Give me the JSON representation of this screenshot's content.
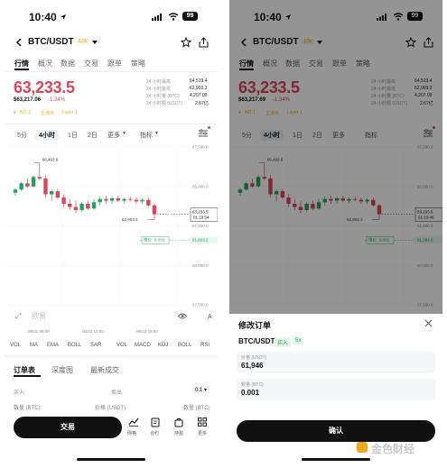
{
  "status": {
    "time": "10:40",
    "battery": "99"
  },
  "header": {
    "pair": "BTC/USDT",
    "leverage": "10x"
  },
  "tabs": [
    "行情",
    "概况",
    "数据",
    "交易",
    "跟单",
    "策略"
  ],
  "price": {
    "last": "63,233.5",
    "last_modal": "63,233.5",
    "usd": "$63,217.06",
    "usd_modal": "$63,217.69",
    "change": "-1.34%",
    "rank": "NO.1",
    "tag_main": "主流币",
    "tag_layer": "Layer 1"
  },
  "stats": [
    {
      "label": "24 小时最高",
      "value": "64,519.4"
    },
    {
      "label": "24 小时最低",
      "value": "62,903.3"
    },
    {
      "label": "24 小时量 (BTC)",
      "value": "4,207.09"
    },
    {
      "label": "24 小时额 (USDT)",
      "value": "2.67亿"
    }
  ],
  "intervals": [
    "5分",
    "4小时",
    "1日",
    "2日",
    "更多",
    "指标"
  ],
  "chart": {
    "yticks": [
      "67,500.0",
      "65,000.0",
      "62,500.0",
      "60,000.0",
      "57,500.0"
    ],
    "xticks": [
      "06/21 08:00",
      "06/22 12:00",
      "06/23 16:00"
    ],
    "high_label": "66,493.9",
    "low_label": "62,903.3",
    "current_price": "63,233.5",
    "countdown": "01:19:54",
    "countdown_modal": "01:19:46",
    "order_tag": "限价",
    "order_qty": "0.001",
    "order_price": "61,603.2",
    "order_price_modal": "61,094.6",
    "watermark": "欧易"
  },
  "chart_data": {
    "type": "candlestick",
    "ylim": [
      57500,
      67500
    ],
    "high": 66493.9,
    "low": 62903.3,
    "last": 63233.5,
    "candles": [
      {
        "o": 64600,
        "h": 64900,
        "l": 64400,
        "c": 64800
      },
      {
        "o": 64800,
        "h": 65300,
        "l": 64700,
        "c": 65200
      },
      {
        "o": 65200,
        "h": 65500,
        "l": 64900,
        "c": 65000
      },
      {
        "o": 65000,
        "h": 65700,
        "l": 64950,
        "c": 65600
      },
      {
        "o": 65600,
        "h": 66493.9,
        "l": 65400,
        "c": 65500
      },
      {
        "o": 65500,
        "h": 65700,
        "l": 64300,
        "c": 64500
      },
      {
        "o": 64500,
        "h": 64800,
        "l": 64100,
        "c": 64700
      },
      {
        "o": 64700,
        "h": 64850,
        "l": 64200,
        "c": 64300
      },
      {
        "o": 64300,
        "h": 64500,
        "l": 63700,
        "c": 63900
      },
      {
        "o": 63900,
        "h": 64200,
        "l": 63500,
        "c": 63700
      },
      {
        "o": 63700,
        "h": 64100,
        "l": 63300,
        "c": 63500
      },
      {
        "o": 63500,
        "h": 64000,
        "l": 63400,
        "c": 63900
      },
      {
        "o": 63900,
        "h": 64100,
        "l": 63500,
        "c": 63600
      },
      {
        "o": 63600,
        "h": 64200,
        "l": 63500,
        "c": 64000
      },
      {
        "o": 64000,
        "h": 64350,
        "l": 63800,
        "c": 64200
      },
      {
        "o": 64200,
        "h": 64400,
        "l": 63900,
        "c": 64100
      },
      {
        "o": 64100,
        "h": 64350,
        "l": 63900,
        "c": 64250
      },
      {
        "o": 64250,
        "h": 64400,
        "l": 64000,
        "c": 64100
      },
      {
        "o": 64100,
        "h": 64300,
        "l": 63950,
        "c": 64200
      },
      {
        "o": 64200,
        "h": 64350,
        "l": 64050,
        "c": 64150
      },
      {
        "o": 64150,
        "h": 64300,
        "l": 63900,
        "c": 64050
      },
      {
        "o": 64050,
        "h": 64250,
        "l": 63900,
        "c": 64150
      },
      {
        "o": 64150,
        "h": 64300,
        "l": 63700,
        "c": 63800
      },
      {
        "o": 63800,
        "h": 63900,
        "l": 62903.3,
        "c": 63233.5
      }
    ]
  },
  "indicators": [
    "VOL",
    "MA",
    "EMA",
    "BOLL",
    "SAR",
    "VOL",
    "MACD",
    "KDJ",
    "BOLL",
    "RSI"
  ],
  "orderbook": {
    "tabs": [
      "订单表",
      "深度图",
      "最新成交"
    ],
    "buy_label": "买入",
    "sell_label": "卖出",
    "step": "0.1",
    "col_qty": "数量 (BTC)",
    "col_price": "价格 (USDT)",
    "col_qty2": "数量 (BTC)"
  },
  "bottom": {
    "trade_button": "交易",
    "nav": [
      "网格",
      "合约",
      "持盈",
      "更多"
    ]
  },
  "modal": {
    "title": "修改订单",
    "pair": "BTC/USDT",
    "side": "买入",
    "leverage": "5x",
    "price_label": "价格 (USDT)",
    "price_value": "61,946",
    "qty_label": "数量 (BTC)",
    "qty_value": "0.001",
    "confirm": "确认",
    "brand": "金色财经"
  },
  "colors": {
    "up": "#1ea55d",
    "down": "#d9465a",
    "accent": "#f2a71b"
  }
}
